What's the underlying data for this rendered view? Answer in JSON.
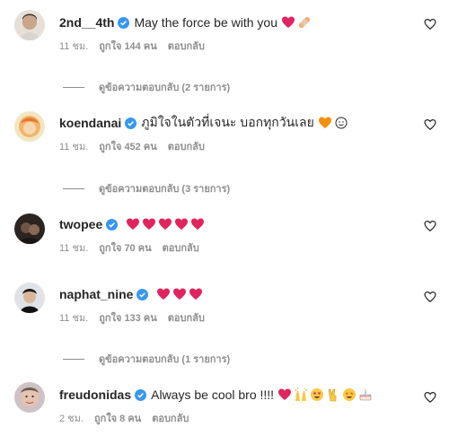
{
  "comments": [
    {
      "username": "2nd__4th",
      "text": "May the force be with you",
      "emojis": [
        "red-heart",
        "bandage"
      ],
      "time": "11 ชม.",
      "likes": "ถูกใจ 144 คน",
      "reply": "ตอบกลับ",
      "replies": "ดูข้อความตอบกลับ (2 รายการ)"
    },
    {
      "username": "koendanai",
      "text": "ภูมิใจในตัวที่เจนะ บอกทุกวันเลย",
      "emojis": [
        "orange-heart",
        "smile"
      ],
      "time": "11 ชม.",
      "likes": "ถูกใจ 452 คน",
      "reply": "ตอบกลับ",
      "replies": "ดูข้อความตอบกลับ (3 รายการ)"
    },
    {
      "username": "twopee",
      "text": "",
      "emojis": [
        "red-heart",
        "red-heart",
        "red-heart",
        "red-heart",
        "red-heart"
      ],
      "time": "11 ชม.",
      "likes": "ถูกใจ 70 คน",
      "reply": "ตอบกลับ",
      "replies": ""
    },
    {
      "username": "naphat_nine",
      "text": "",
      "emojis": [
        "red-heart",
        "red-heart",
        "red-heart"
      ],
      "time": "11 ชม.",
      "likes": "ถูกใจ 133 คน",
      "reply": "ตอบกลับ",
      "replies": "ดูข้อความตอบกลับ (1 รายการ)"
    },
    {
      "username": "freudonidas",
      "text": "Always be cool bro !!!!",
      "emojis": [
        "red-heart",
        "raised-hands",
        "heart-eyes",
        "victory-hand",
        "star-struck",
        "cake"
      ],
      "time": "2 ชม.",
      "likes": "ถูกใจ 8 คน",
      "reply": "ตอบกลับ",
      "replies": ""
    }
  ],
  "colors": {
    "verified": "#3897f0",
    "meta_text": "#8e8e8e",
    "red_heart": "#e0245e",
    "orange_heart": "#f4900c"
  }
}
